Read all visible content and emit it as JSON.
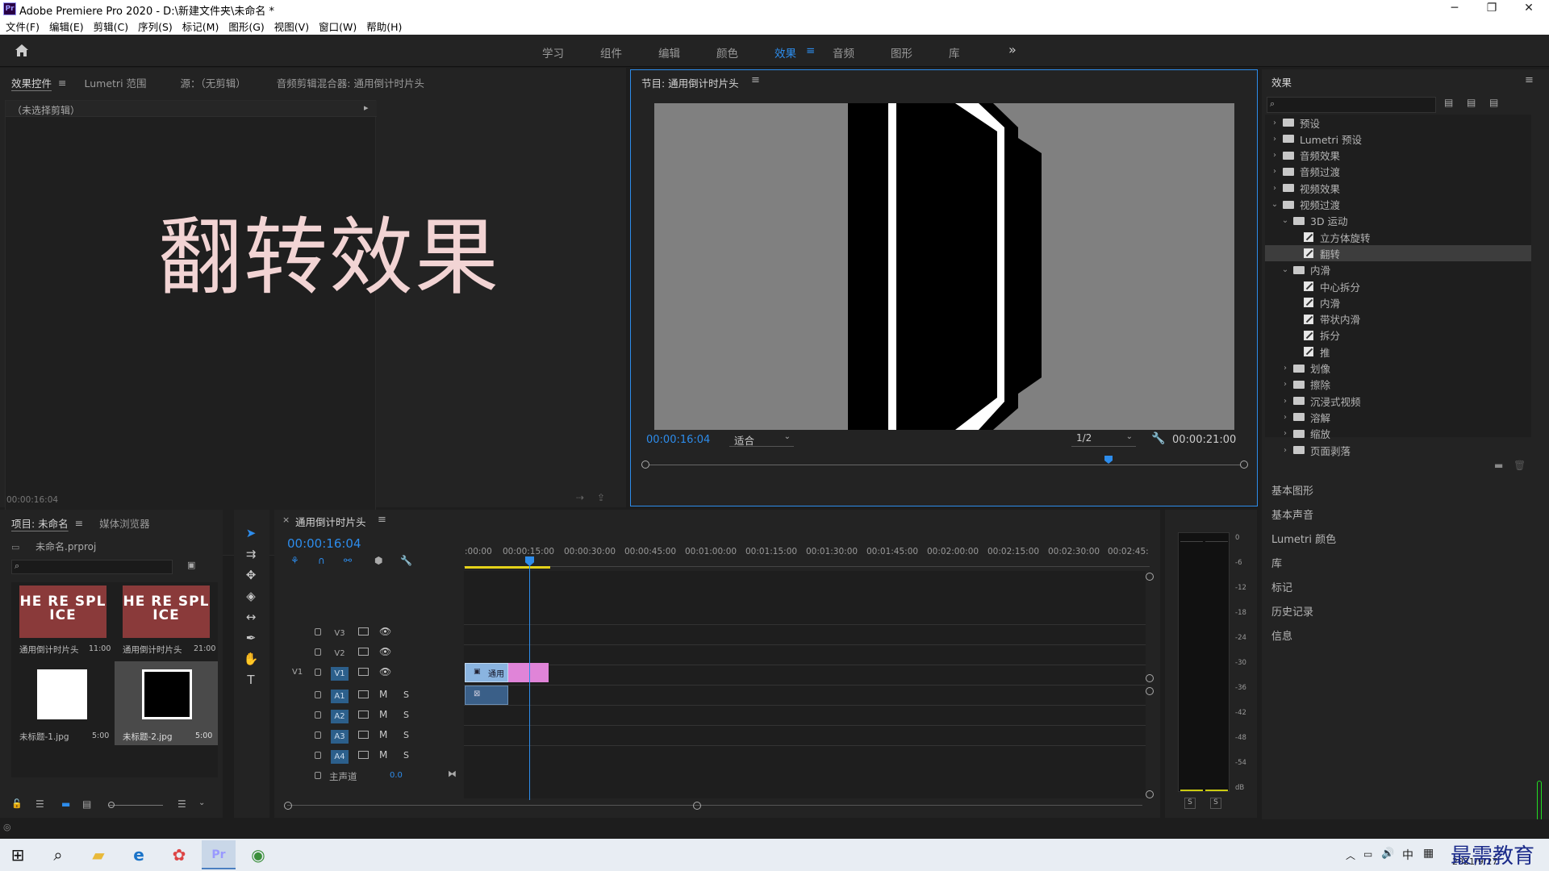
{
  "titlebar": {
    "logo": "Pr",
    "title": "Adobe Premiere Pro 2020 - D:\\新建文件夹\\未命名 *",
    "min": "─",
    "max": "❐",
    "close": "✕"
  },
  "menu": [
    "文件(F)",
    "编辑(E)",
    "剪辑(C)",
    "序列(S)",
    "标记(M)",
    "图形(G)",
    "视图(V)",
    "窗口(W)",
    "帮助(H)"
  ],
  "workspaces": {
    "items": [
      "学习",
      "组件",
      "编辑",
      "颜色",
      "效果",
      "音频",
      "图形",
      "库"
    ],
    "active": "效果",
    "more": "»"
  },
  "source_panel": {
    "tabs": [
      "效果控件",
      "Lumetri 范围",
      "源：（无剪辑）",
      "音频剪辑混合器: 通用倒计时片头"
    ],
    "no_clip": "（未选择剪辑）",
    "overlay_title": "翻转效果",
    "timecode": "00:00:16:04"
  },
  "program_monitor": {
    "title": "节目: 通用倒计时片头",
    "timecode": "00:00:16:04",
    "fit": "适合",
    "resolution": "1/2",
    "duration": "00:00:21:00",
    "playhead_position": 0.77
  },
  "effects_panel": {
    "title": "效果",
    "items": [
      {
        "label": "预设",
        "kind": "folder",
        "level": 0,
        "chev": "›"
      },
      {
        "label": "Lumetri 预设",
        "kind": "folder",
        "level": 0,
        "chev": "›"
      },
      {
        "label": "音频效果",
        "kind": "folder",
        "level": 0,
        "chev": "›"
      },
      {
        "label": "音频过渡",
        "kind": "folder",
        "level": 0,
        "chev": "›"
      },
      {
        "label": "视频效果",
        "kind": "folder",
        "level": 0,
        "chev": "›"
      },
      {
        "label": "视频过渡",
        "kind": "folder",
        "level": 0,
        "chev": "⌄"
      },
      {
        "label": "3D 运动",
        "kind": "folder",
        "level": 1,
        "chev": "⌄"
      },
      {
        "label": "立方体旋转",
        "kind": "fx",
        "level": 2
      },
      {
        "label": "翻转",
        "kind": "fx",
        "level": 2,
        "selected": true
      },
      {
        "label": "内滑",
        "kind": "folder",
        "level": 1,
        "chev": "⌄"
      },
      {
        "label": "中心拆分",
        "kind": "fx",
        "level": 2
      },
      {
        "label": "内滑",
        "kind": "fx",
        "level": 2
      },
      {
        "label": "带状内滑",
        "kind": "fx",
        "level": 2
      },
      {
        "label": "拆分",
        "kind": "fx",
        "level": 2
      },
      {
        "label": "推",
        "kind": "fx",
        "level": 2
      },
      {
        "label": "划像",
        "kind": "folder",
        "level": 1,
        "chev": "›"
      },
      {
        "label": "擦除",
        "kind": "folder",
        "level": 1,
        "chev": "›"
      },
      {
        "label": "沉浸式视频",
        "kind": "folder",
        "level": 1,
        "chev": "›"
      },
      {
        "label": "溶解",
        "kind": "folder",
        "level": 1,
        "chev": "›"
      },
      {
        "label": "缩放",
        "kind": "folder",
        "level": 1,
        "chev": "›"
      },
      {
        "label": "页面剥落",
        "kind": "folder",
        "level": 1,
        "chev": "›"
      }
    ],
    "panel_links": [
      "基本图形",
      "基本声音",
      "Lumetri 颜色",
      "库",
      "标记",
      "历史记录",
      "信息"
    ]
  },
  "project_panel": {
    "tabs": [
      "项目: 未命名",
      "媒体浏览器"
    ],
    "project_file": "未命名.prproj",
    "items": [
      {
        "name": "通用倒计时片头",
        "dur": "11:00",
        "thumb": "HE RE SPL ICE"
      },
      {
        "name": "通用倒计时片头",
        "dur": "21:00",
        "thumb": "HE RE SPL ICE"
      },
      {
        "name": "未标题-1.jpg",
        "dur": "5:00",
        "thumb": "white"
      },
      {
        "name": "未标题-2.jpg",
        "dur": "5:00",
        "thumb": "black"
      }
    ]
  },
  "timeline": {
    "sequence_tab": "通用倒计时片头",
    "timecode": "00:00:16:04",
    "ruler": [
      ":00:00",
      "00:00:15:00",
      "00:00:30:00",
      "00:00:45:00",
      "00:01:00:00",
      "00:01:15:00",
      "00:01:30:00",
      "00:01:45:00",
      "00:02:00:00",
      "00:02:15:00",
      "00:02:30:00",
      "00:02:45:"
    ],
    "video_tracks": [
      "V3",
      "V2",
      "V1"
    ],
    "source_patch": "V1",
    "audio_tracks": [
      "A1",
      "A2",
      "A3",
      "A4"
    ],
    "mute": "M",
    "solo": "S",
    "master_label": "主声道",
    "master_value": "0.0",
    "clip_label": "通用"
  },
  "audio_meter": {
    "scale": [
      "0",
      "-6",
      "-12",
      "-18",
      "-24",
      "-30",
      "-36",
      "-42",
      "-48",
      "-54",
      "dB"
    ],
    "solo_a": "S",
    "solo_b": "S"
  },
  "taskbar": {
    "ime": "中",
    "time": "2021/9/27",
    "watermark": "最需教育"
  },
  "colors": {
    "accent": "#2d8ceb",
    "overlay_text": "#f2d4d4",
    "video_clip": "#8ab4e0",
    "transition": "#e084d8",
    "audio_clip": "#3a5f88"
  }
}
